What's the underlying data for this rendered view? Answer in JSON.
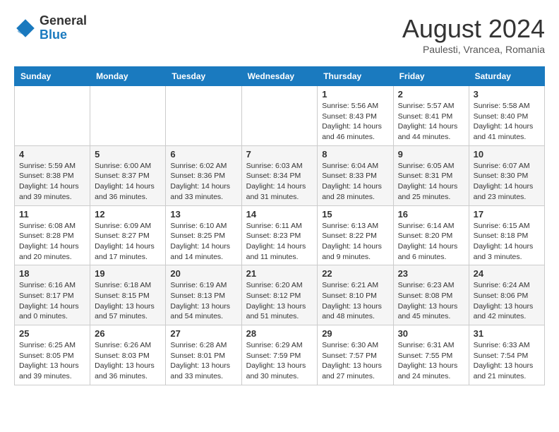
{
  "header": {
    "logo": {
      "line1": "General",
      "line2": "Blue"
    },
    "title": "August 2024",
    "subtitle": "Paulesti, Vrancea, Romania"
  },
  "weekdays": [
    "Sunday",
    "Monday",
    "Tuesday",
    "Wednesday",
    "Thursday",
    "Friday",
    "Saturday"
  ],
  "weeks": [
    [
      {
        "day": "",
        "info": ""
      },
      {
        "day": "",
        "info": ""
      },
      {
        "day": "",
        "info": ""
      },
      {
        "day": "",
        "info": ""
      },
      {
        "day": "1",
        "info": "Sunrise: 5:56 AM\nSunset: 8:43 PM\nDaylight: 14 hours\nand 46 minutes."
      },
      {
        "day": "2",
        "info": "Sunrise: 5:57 AM\nSunset: 8:41 PM\nDaylight: 14 hours\nand 44 minutes."
      },
      {
        "day": "3",
        "info": "Sunrise: 5:58 AM\nSunset: 8:40 PM\nDaylight: 14 hours\nand 41 minutes."
      }
    ],
    [
      {
        "day": "4",
        "info": "Sunrise: 5:59 AM\nSunset: 8:38 PM\nDaylight: 14 hours\nand 39 minutes."
      },
      {
        "day": "5",
        "info": "Sunrise: 6:00 AM\nSunset: 8:37 PM\nDaylight: 14 hours\nand 36 minutes."
      },
      {
        "day": "6",
        "info": "Sunrise: 6:02 AM\nSunset: 8:36 PM\nDaylight: 14 hours\nand 33 minutes."
      },
      {
        "day": "7",
        "info": "Sunrise: 6:03 AM\nSunset: 8:34 PM\nDaylight: 14 hours\nand 31 minutes."
      },
      {
        "day": "8",
        "info": "Sunrise: 6:04 AM\nSunset: 8:33 PM\nDaylight: 14 hours\nand 28 minutes."
      },
      {
        "day": "9",
        "info": "Sunrise: 6:05 AM\nSunset: 8:31 PM\nDaylight: 14 hours\nand 25 minutes."
      },
      {
        "day": "10",
        "info": "Sunrise: 6:07 AM\nSunset: 8:30 PM\nDaylight: 14 hours\nand 23 minutes."
      }
    ],
    [
      {
        "day": "11",
        "info": "Sunrise: 6:08 AM\nSunset: 8:28 PM\nDaylight: 14 hours\nand 20 minutes."
      },
      {
        "day": "12",
        "info": "Sunrise: 6:09 AM\nSunset: 8:27 PM\nDaylight: 14 hours\nand 17 minutes."
      },
      {
        "day": "13",
        "info": "Sunrise: 6:10 AM\nSunset: 8:25 PM\nDaylight: 14 hours\nand 14 minutes."
      },
      {
        "day": "14",
        "info": "Sunrise: 6:11 AM\nSunset: 8:23 PM\nDaylight: 14 hours\nand 11 minutes."
      },
      {
        "day": "15",
        "info": "Sunrise: 6:13 AM\nSunset: 8:22 PM\nDaylight: 14 hours\nand 9 minutes."
      },
      {
        "day": "16",
        "info": "Sunrise: 6:14 AM\nSunset: 8:20 PM\nDaylight: 14 hours\nand 6 minutes."
      },
      {
        "day": "17",
        "info": "Sunrise: 6:15 AM\nSunset: 8:18 PM\nDaylight: 14 hours\nand 3 minutes."
      }
    ],
    [
      {
        "day": "18",
        "info": "Sunrise: 6:16 AM\nSunset: 8:17 PM\nDaylight: 14 hours\nand 0 minutes."
      },
      {
        "day": "19",
        "info": "Sunrise: 6:18 AM\nSunset: 8:15 PM\nDaylight: 13 hours\nand 57 minutes."
      },
      {
        "day": "20",
        "info": "Sunrise: 6:19 AM\nSunset: 8:13 PM\nDaylight: 13 hours\nand 54 minutes."
      },
      {
        "day": "21",
        "info": "Sunrise: 6:20 AM\nSunset: 8:12 PM\nDaylight: 13 hours\nand 51 minutes."
      },
      {
        "day": "22",
        "info": "Sunrise: 6:21 AM\nSunset: 8:10 PM\nDaylight: 13 hours\nand 48 minutes."
      },
      {
        "day": "23",
        "info": "Sunrise: 6:23 AM\nSunset: 8:08 PM\nDaylight: 13 hours\nand 45 minutes."
      },
      {
        "day": "24",
        "info": "Sunrise: 6:24 AM\nSunset: 8:06 PM\nDaylight: 13 hours\nand 42 minutes."
      }
    ],
    [
      {
        "day": "25",
        "info": "Sunrise: 6:25 AM\nSunset: 8:05 PM\nDaylight: 13 hours\nand 39 minutes."
      },
      {
        "day": "26",
        "info": "Sunrise: 6:26 AM\nSunset: 8:03 PM\nDaylight: 13 hours\nand 36 minutes."
      },
      {
        "day": "27",
        "info": "Sunrise: 6:28 AM\nSunset: 8:01 PM\nDaylight: 13 hours\nand 33 minutes."
      },
      {
        "day": "28",
        "info": "Sunrise: 6:29 AM\nSunset: 7:59 PM\nDaylight: 13 hours\nand 30 minutes."
      },
      {
        "day": "29",
        "info": "Sunrise: 6:30 AM\nSunset: 7:57 PM\nDaylight: 13 hours\nand 27 minutes."
      },
      {
        "day": "30",
        "info": "Sunrise: 6:31 AM\nSunset: 7:55 PM\nDaylight: 13 hours\nand 24 minutes."
      },
      {
        "day": "31",
        "info": "Sunrise: 6:33 AM\nSunset: 7:54 PM\nDaylight: 13 hours\nand 21 minutes."
      }
    ]
  ]
}
